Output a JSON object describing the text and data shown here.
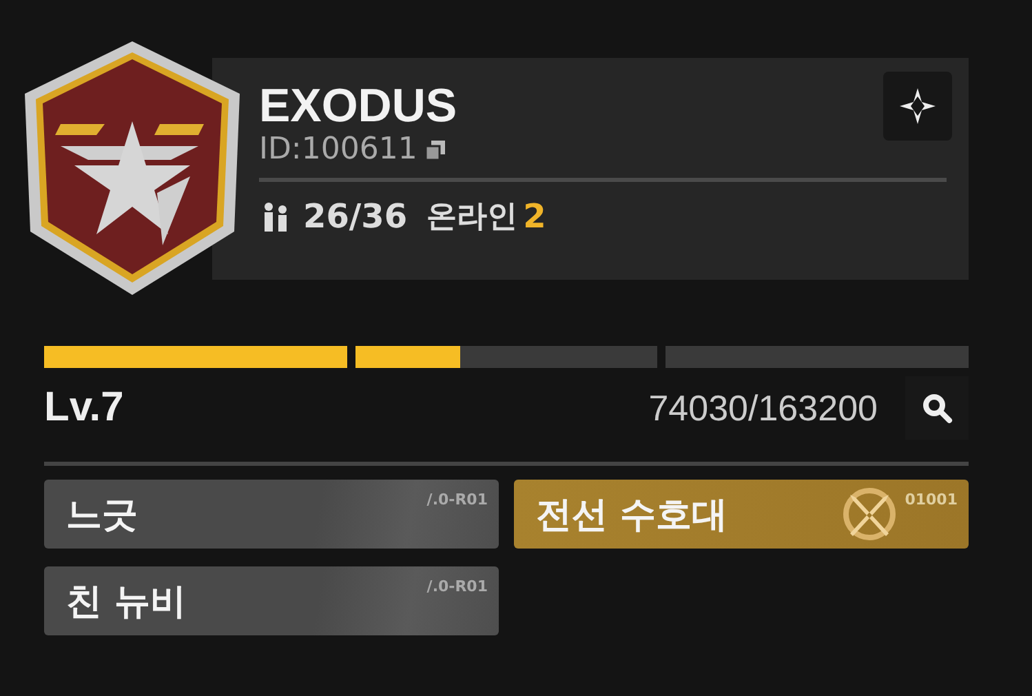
{
  "guild": {
    "name": "EXODUS",
    "id": "ID:100611",
    "members": "26/36",
    "online_label": "온라인",
    "online_count": "2"
  },
  "progress": {
    "level": 0.45,
    "level_label": "Lv.7",
    "reading": "74030/163200"
  },
  "tags": [
    {
      "label": "느긋",
      "code": "/.0-R01",
      "kind": "plain"
    },
    {
      "label": "전선 수호대",
      "code": "01001",
      "kind": "gold"
    },
    {
      "label": "친 뉴비",
      "code": "/.0-R01",
      "kind": "plain"
    }
  ]
}
